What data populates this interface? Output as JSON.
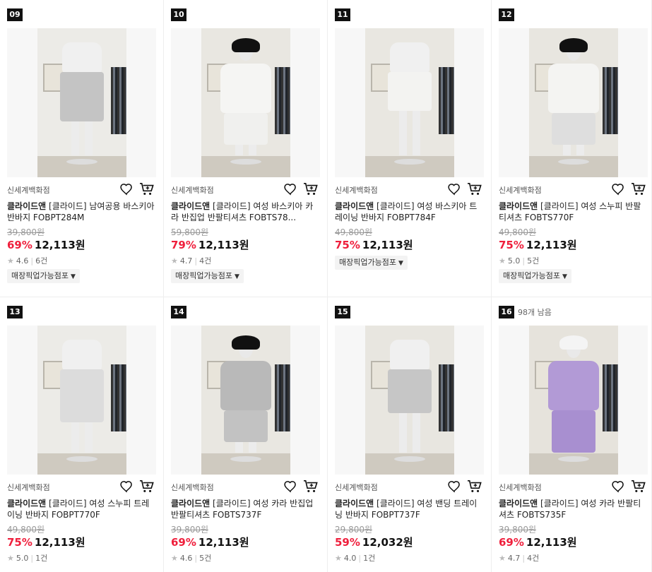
{
  "products": [
    {
      "rank": "09",
      "remain": "",
      "seller": "신세계백화점",
      "brand": "클라이드앤",
      "name": "[클라이드] 남여공용 바스키아 반바지 FOBPT284M",
      "original_price": "39,800원",
      "discount": "69%",
      "price": "12,113원",
      "rating": "4.6",
      "reviews": "6건",
      "pickup": "매장픽업가능점포",
      "photo": {
        "wall": "#ecebe7",
        "top": "#c9c9c9",
        "bottom": "#c4c4c4",
        "hat": "",
        "bottom_h": 70,
        "shorts_only": true
      }
    },
    {
      "rank": "10",
      "remain": "",
      "seller": "신세계백화점",
      "brand": "클라이드앤",
      "name": "[클라이드] 여성 바스키아 카라 반집업 반팔티셔츠 FOBTS78...",
      "original_price": "59,800원",
      "discount": "79%",
      "price": "12,113원",
      "rating": "4.7",
      "reviews": "4건",
      "pickup": "매장픽업가능점포",
      "photo": {
        "wall": "#e9e7e1",
        "top": "#f5f5f3",
        "bottom": "#f0f0ee",
        "hat": "#111",
        "bottom_h": 45,
        "shorts_only": false
      }
    },
    {
      "rank": "11",
      "remain": "",
      "seller": "신세계백화점",
      "brand": "클라이드앤",
      "name": "[클라이드] 여성 바스키아 트레이닝 반바지 FOBPT784F",
      "original_price": "49,800원",
      "discount": "75%",
      "price": "12,113원",
      "rating": "",
      "reviews": "",
      "pickup": "매장픽업가능점포",
      "photo": {
        "wall": "#e9e7e1",
        "top": "#f3f3f1",
        "bottom": "#f3f3f1",
        "hat": "",
        "bottom_h": 55,
        "shorts_only": true
      }
    },
    {
      "rank": "12",
      "remain": "",
      "seller": "신세계백화점",
      "brand": "클라이드앤",
      "name": "[클라이드] 여성 스누피 반팔티셔츠 FOBTS770F",
      "original_price": "49,800원",
      "discount": "75%",
      "price": "12,113원",
      "rating": "5.0",
      "reviews": "5건",
      "pickup": "매장픽업가능점포",
      "photo": {
        "wall": "#e8e6e0",
        "top": "#f4f4f2",
        "bottom": "#dedede",
        "hat": "#111",
        "bottom_h": 45,
        "shorts_only": false
      }
    },
    {
      "rank": "13",
      "remain": "",
      "seller": "신세계백화점",
      "brand": "클라이드앤",
      "name": "[클라이드] 여성 스누피 트레이닝 반바지 FOBPT770F",
      "original_price": "49,800원",
      "discount": "75%",
      "price": "12,113원",
      "rating": "5.0",
      "reviews": "1건",
      "pickup": "",
      "photo": {
        "wall": "#ecebe7",
        "top": "#dcdcdc",
        "bottom": "#dcdcdc",
        "hat": "",
        "bottom_h": 75,
        "shorts_only": true
      }
    },
    {
      "rank": "14",
      "remain": "",
      "seller": "신세계백화점",
      "brand": "클라이드앤",
      "name": "[클라이드] 여성 카라 반집업 반팔티셔츠 FOBTS737F",
      "original_price": "39,800원",
      "discount": "69%",
      "price": "12,113원",
      "rating": "4.6",
      "reviews": "5건",
      "pickup": "",
      "photo": {
        "wall": "#e9e7e1",
        "top": "#b9b9b9",
        "bottom": "#c2c2c2",
        "hat": "#111",
        "bottom_h": 45,
        "shorts_only": false
      }
    },
    {
      "rank": "15",
      "remain": "",
      "seller": "신세계백화점",
      "brand": "클라이드앤",
      "name": "[클라이드] 여성 밴딩 트레이닝 반바지 FOBPT737F",
      "original_price": "29,800원",
      "discount": "59%",
      "price": "12,032원",
      "rating": "4.0",
      "reviews": "1건",
      "pickup": "",
      "photo": {
        "wall": "#e8e6e0",
        "top": "#c6c6c6",
        "bottom": "#c6c6c6",
        "hat": "",
        "bottom_h": 62,
        "shorts_only": true
      }
    },
    {
      "rank": "16",
      "remain": "98개 남음",
      "seller": "신세계백화점",
      "brand": "클라이드앤",
      "name": "[클라이드] 여성 카라 반팔티셔츠 FOBTS735F",
      "original_price": "39,800원",
      "discount": "69%",
      "price": "12,113원",
      "rating": "4.7",
      "reviews": "4건",
      "pickup": "",
      "photo": {
        "wall": "#e6e3dc",
        "top": "#b29ad6",
        "bottom": "#a88fd0",
        "hat": "#f4f4f4",
        "bottom_h": 60,
        "shorts_only": false
      }
    }
  ],
  "icons": {
    "heart": "heart-icon",
    "cart": "cart-icon",
    "star": "star-icon",
    "dropdown": "caret-down-icon"
  },
  "colors": {
    "discount": "#ef1f3c",
    "rank_badge": "#111111"
  }
}
